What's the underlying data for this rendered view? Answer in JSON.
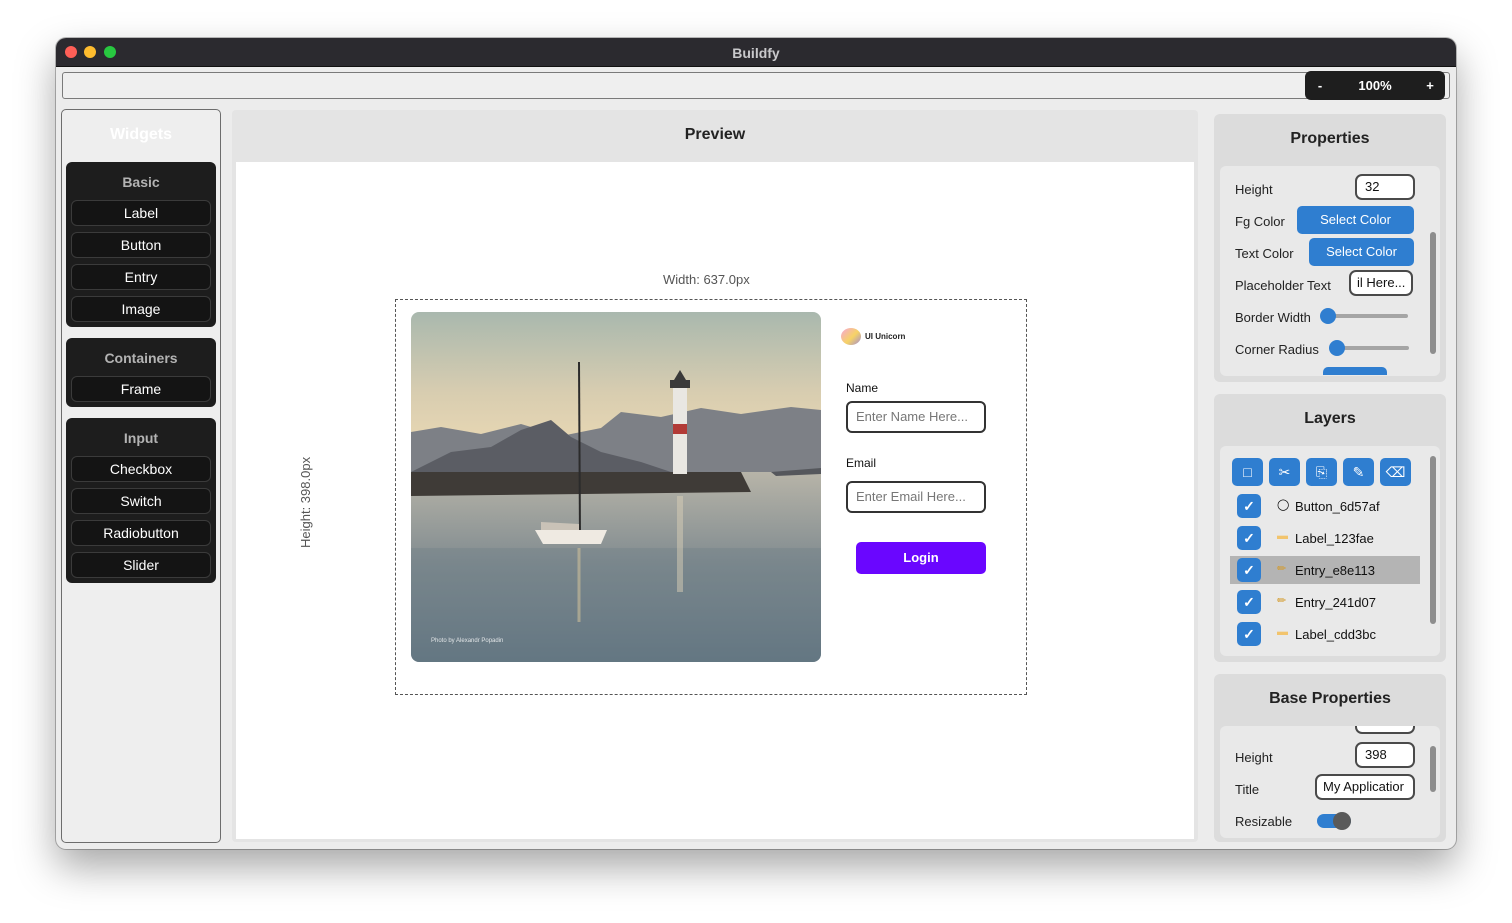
{
  "window": {
    "title": "Buildfy"
  },
  "zoom": {
    "minus": "-",
    "value": "100%",
    "plus": "+"
  },
  "sidebar": {
    "title": "Widgets",
    "groups": [
      {
        "title": "Basic",
        "items": [
          "Label",
          "Button",
          "Entry",
          "Image"
        ]
      },
      {
        "title": "Containers",
        "items": [
          "Frame"
        ]
      },
      {
        "title": "Input",
        "items": [
          "Checkbox",
          "Switch",
          "Radiobutton",
          "Slider"
        ]
      }
    ]
  },
  "preview": {
    "title": "Preview",
    "width_label": "Width: 637.0px",
    "height_label": "Height: 398.0px",
    "app": {
      "photo_credit": "Photo by Alexandr Popadin",
      "logo_text": "UI Unicorn",
      "name_label": "Name",
      "name_placeholder": "Enter Name Here...",
      "email_label": "Email",
      "email_placeholder": "Enter Email Here...",
      "login_label": "Login"
    }
  },
  "properties": {
    "title": "Properties",
    "height_label": "Height",
    "height_value": "32",
    "fg_color_label": "Fg Color",
    "fg_color_button": "Select Color",
    "text_color_label": "Text Color",
    "text_color_button": "Select Color",
    "placeholder_label": "Placeholder Text",
    "placeholder_value": "il Here...",
    "border_width_label": "Border Width",
    "corner_radius_label": "Corner Radius",
    "border_width_level": 0,
    "corner_radius_level": 0
  },
  "layers": {
    "title": "Layers",
    "tools": [
      "doc-icon",
      "scissors-icon",
      "clipboard-icon",
      "edit-icon",
      "trash-icon"
    ],
    "items": [
      {
        "icon": "radio-icon",
        "name": "Button_6d57af",
        "checked": true
      },
      {
        "icon": "tag-icon",
        "name": "Label_123fae",
        "checked": true
      },
      {
        "icon": "pencil-icon",
        "name": "Entry_e8e113",
        "checked": true,
        "selected": true
      },
      {
        "icon": "pencil-icon",
        "name": "Entry_241d07",
        "checked": true
      },
      {
        "icon": "tag-icon",
        "name": "Label_cdd3bc",
        "checked": true
      }
    ]
  },
  "base_properties": {
    "title": "Base Properties",
    "height_label": "Height",
    "height_value": "398",
    "title_label": "Title",
    "title_value": "My Applicatior",
    "resizable_label": "Resizable",
    "resizable": true
  },
  "colors": {
    "accent": "#2f7ed0",
    "login": "#6a06ff",
    "sidebar_group": "#1d1d1d"
  }
}
